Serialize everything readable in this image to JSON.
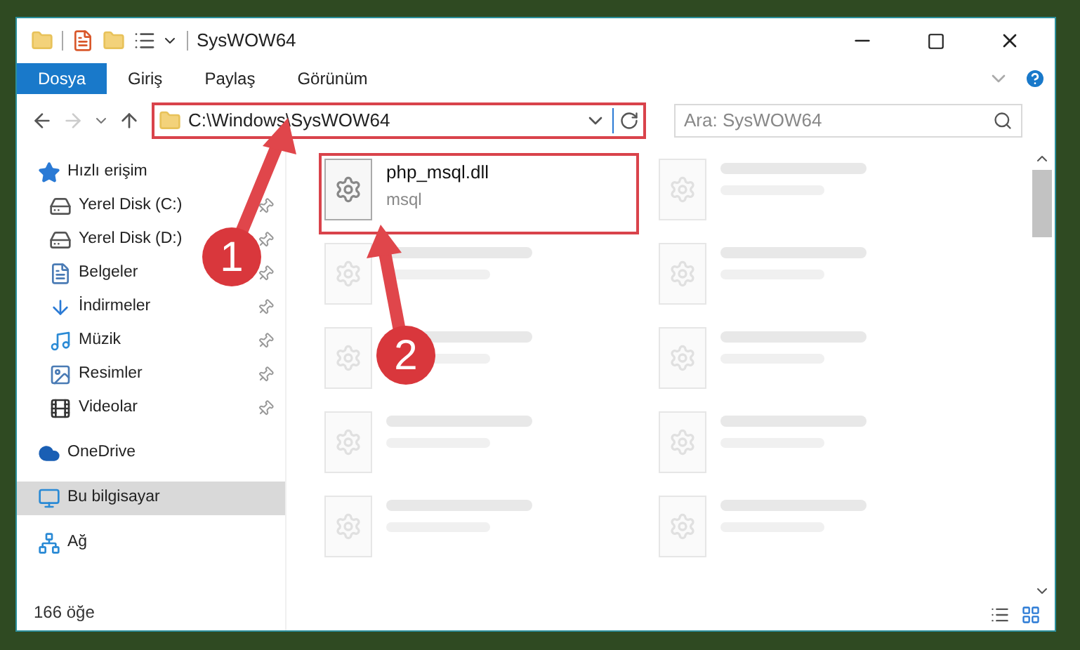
{
  "window": {
    "title": "SysWOW64"
  },
  "ribbon": {
    "tabs": [
      {
        "label": "Dosya",
        "selected": true
      },
      {
        "label": "Giriş",
        "selected": false
      },
      {
        "label": "Paylaş",
        "selected": false
      },
      {
        "label": "Görünüm",
        "selected": false
      }
    ]
  },
  "address_bar": {
    "path": "C:\\Windows\\SysWOW64"
  },
  "search": {
    "placeholder": "Ara: SysWOW64"
  },
  "sidebar": {
    "items": [
      {
        "label": "Hızlı erişim",
        "kind": "star",
        "selected": false,
        "children": [
          {
            "label": "Yerel Disk (C:)",
            "kind": "drive",
            "pinned": true,
            "selected": false
          },
          {
            "label": "Yerel Disk (D:)",
            "kind": "drive",
            "pinned": true,
            "selected": false
          },
          {
            "label": "Belgeler",
            "kind": "docs",
            "pinned": true,
            "selected": false
          },
          {
            "label": "İndirmeler",
            "kind": "download",
            "pinned": true,
            "selected": false
          },
          {
            "label": "Müzik",
            "kind": "music",
            "pinned": true,
            "selected": false
          },
          {
            "label": "Resimler",
            "kind": "pictures",
            "pinned": true,
            "selected": false
          },
          {
            "label": "Videolar",
            "kind": "video",
            "pinned": true,
            "selected": false
          }
        ]
      },
      {
        "label": "OneDrive",
        "kind": "cloud",
        "selected": false
      },
      {
        "label": "Bu bilgisayar",
        "kind": "pc",
        "selected": true
      },
      {
        "label": "Ağ",
        "kind": "network",
        "selected": false
      }
    ]
  },
  "files": [
    {
      "kind": "file",
      "name": "php_msql.dll",
      "type": "msql",
      "highlighted": true
    },
    {
      "kind": "blurred"
    },
    {
      "kind": "blurred"
    },
    {
      "kind": "blurred"
    },
    {
      "kind": "blurred"
    },
    {
      "kind": "blurred"
    },
    {
      "kind": "blurred"
    },
    {
      "kind": "blurred"
    },
    {
      "kind": "blurred"
    },
    {
      "kind": "blurred"
    }
  ],
  "status_bar": {
    "count": "166 öğe"
  },
  "annotations": [
    {
      "number": "1"
    },
    {
      "number": "2"
    }
  ]
}
